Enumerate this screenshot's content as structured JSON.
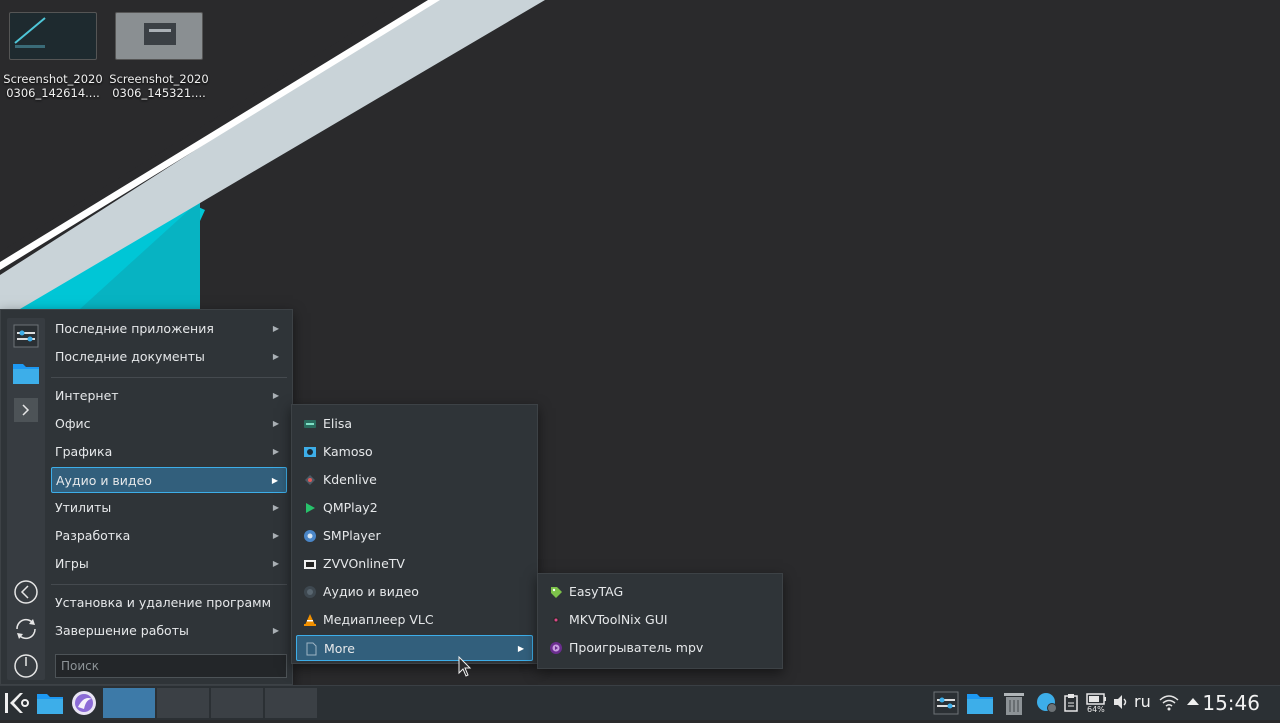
{
  "desktop": {
    "icons": [
      {
        "name": "Screenshot_2020\n0306_142614....",
        "thumb_color": "#1e2a2f"
      },
      {
        "name": "Screenshot_2020\n0306_145321....",
        "thumb_color": "#8a8f92"
      }
    ],
    "colors": {
      "cyan": "#00c6d6",
      "light_stripe": "#c9d3d8",
      "white_stripe": "#ffffff"
    }
  },
  "launcher": {
    "favorites": [
      "settings-icon",
      "folder-icon",
      "terminal-icon"
    ],
    "items": [
      {
        "label": "Последние приложения",
        "has_submenu": true
      },
      {
        "label": "Последние документы",
        "has_submenu": true
      },
      {
        "label": "Интернет",
        "has_submenu": true
      },
      {
        "label": "Офис",
        "has_submenu": true
      },
      {
        "label": "Графика",
        "has_submenu": true
      },
      {
        "label": "Аудио и видео",
        "has_submenu": true,
        "active": true
      },
      {
        "label": "Утилиты",
        "has_submenu": true
      },
      {
        "label": "Разработка",
        "has_submenu": true
      },
      {
        "label": "Игры",
        "has_submenu": true
      },
      {
        "label": "Установка и удаление программ",
        "has_submenu": false
      },
      {
        "label": "Завершение работы",
        "has_submenu": true
      }
    ],
    "session_buttons": [
      "back-icon",
      "switch-user-icon",
      "power-icon"
    ],
    "search": {
      "placeholder": "Поиск"
    },
    "arrow": "▶"
  },
  "audio_submenu": {
    "items": [
      {
        "label": "Elisa",
        "icon": "elisa-icon"
      },
      {
        "label": "Kamoso",
        "icon": "kamoso-icon"
      },
      {
        "label": "Kdenlive",
        "icon": "kdenlive-icon"
      },
      {
        "label": "QMPlay2",
        "icon": "qmplay2-icon"
      },
      {
        "label": "SMPlayer",
        "icon": "smplayer-icon"
      },
      {
        "label": "ZVVOnlineTV",
        "icon": "tv-icon"
      },
      {
        "label": "Аудио и видео",
        "icon": "audio-video-icon"
      },
      {
        "label": "Медиаплеер VLC",
        "icon": "vlc-icon"
      },
      {
        "label": "More",
        "icon": "document-icon",
        "active": true
      }
    ]
  },
  "more_submenu": {
    "items": [
      {
        "label": "EasyTAG",
        "icon": "easytag-icon"
      },
      {
        "label": "MKVToolNix GUI",
        "icon": "mkvtoolnix-icon"
      },
      {
        "label": "Проигрыватель mpv",
        "icon": "mpv-icon"
      }
    ]
  },
  "taskbar": {
    "language": "ru",
    "battery": "64%",
    "clock": "15:46",
    "accent": "#3d7aa8"
  }
}
